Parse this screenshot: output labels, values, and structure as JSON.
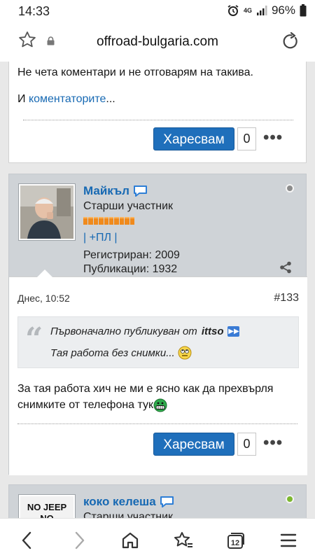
{
  "status_bar": {
    "time": "14:33",
    "network": "4G",
    "battery": "96%"
  },
  "browser": {
    "domain": "offroad-bulgaria.com"
  },
  "prev_post": {
    "line1": "Не чета коментари и не отговарям на такива.",
    "line2_prefix": "И ",
    "line2_link": "коментаторите",
    "line2_suffix": "...",
    "like_label": "Харесвам",
    "like_count": "0",
    "more": "•••"
  },
  "post": {
    "username": "Майкъл",
    "role": "Старши участник",
    "reputation_segments": 10,
    "user_links": "| +ПЛ |",
    "registered": "Регистриран: 2009",
    "publications": "Публикации: 1932",
    "online_status_color": "#8c8c8c",
    "date": "Днес, 10:52",
    "post_number": "#133",
    "quote_prefix": "Първоначално публикуван от",
    "quote_author": "ittso",
    "quote_text": "Тая работа без снимки...",
    "message_line1": "За тая работа хич не ми е ясно как да прехвърля",
    "message_line2": "снимките от телефона тук",
    "like_label": "Харесвам",
    "like_count": "0",
    "more": "•••"
  },
  "next_post": {
    "username": "коко келеша",
    "role": "Старши участник",
    "avatar_text_line1": "NO JEEP",
    "avatar_text_line2": "NO",
    "online_status_color": "#7cb82f"
  },
  "colors": {
    "accent": "#1769b3",
    "button": "#1f6fbb"
  }
}
